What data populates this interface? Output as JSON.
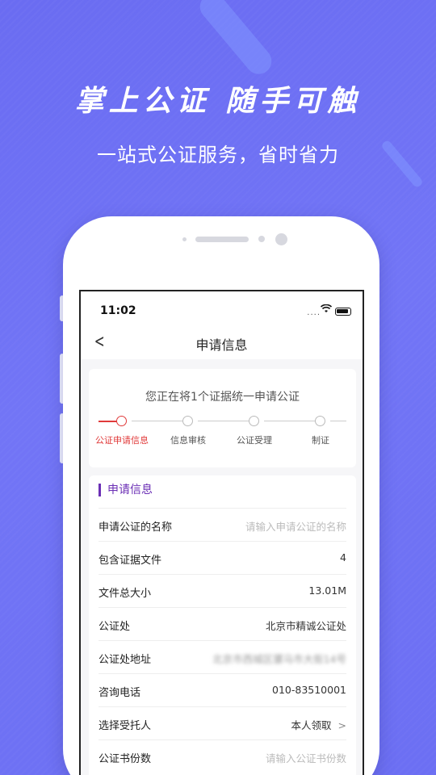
{
  "promo": {
    "headline": "掌上公证 随手可触",
    "subline": "一站式公证服务，省时省力"
  },
  "status_bar": {
    "time": "11:02",
    "signal": "....",
    "wifi": "wifi-icon",
    "battery": "battery-icon"
  },
  "nav": {
    "back": "<",
    "title": "申请信息"
  },
  "progress": {
    "hint": "您正在将1个证据统一申请公证",
    "steps": [
      {
        "label": "公证申请信息",
        "active": true
      },
      {
        "label": "信息审核",
        "active": false
      },
      {
        "label": "公证受理",
        "active": false
      },
      {
        "label": "制证",
        "active": false
      }
    ]
  },
  "info": {
    "section_title": "申请信息",
    "rows": [
      {
        "label": "申请公证的名称",
        "value": "请输入申请公证的名称",
        "placeholder": true
      },
      {
        "label": "包含证据文件",
        "value": "4"
      },
      {
        "label": "文件总大小",
        "value": "13.01M"
      },
      {
        "label": "公证处",
        "value": "北京市精诚公证处"
      },
      {
        "label": "公证处地址",
        "value": "北京市西城区骡马市大街14号",
        "blurred": true
      },
      {
        "label": "咨询电话",
        "value": "010-83510001"
      },
      {
        "label": "选择受托人",
        "value": "本人领取",
        "chevron": ">"
      },
      {
        "label": "公证书份数",
        "value": "请输入公证书份数",
        "placeholder": true
      }
    ]
  },
  "colors": {
    "background": "#6c6ff3",
    "accent_red": "#e03a3a",
    "section_purple": "#6b2fb5"
  }
}
